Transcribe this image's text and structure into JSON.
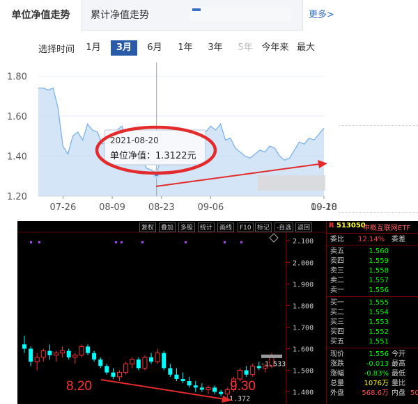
{
  "top_panel": {
    "tabs": [
      {
        "label": "单位净值走势",
        "active": true
      },
      {
        "label": "累计净值走势",
        "active": false
      }
    ],
    "more_label": "更多>",
    "range_label": "选择时间",
    "ranges": [
      {
        "label": "1月",
        "state": "normal"
      },
      {
        "label": "3月",
        "state": "active"
      },
      {
        "label": "6月",
        "state": "normal"
      },
      {
        "label": "1年",
        "state": "normal"
      },
      {
        "label": "3年",
        "state": "normal"
      },
      {
        "label": "5年",
        "state": "disabled"
      },
      {
        "label": "今年来",
        "state": "normal"
      },
      {
        "label": "最大",
        "state": "normal"
      }
    ],
    "tooltip": {
      "date": "2021-08-20",
      "value_label": "单位净值：1.3122元"
    },
    "colors": {
      "area_fill": "#c5dcf5",
      "line": "#7ab3ea",
      "annotation": "#e32b2b",
      "accent": "#2a5ba8"
    }
  },
  "chart_data": [
    {
      "type": "area",
      "title": "单位净值走势",
      "xlabel": "",
      "ylabel": "",
      "y_ticks": [
        "1.20",
        "1.40",
        "1.60",
        "1.80"
      ],
      "ylim": [
        1.2,
        1.85
      ],
      "x_ticks": [
        "07-26",
        "08-09",
        "08-23",
        "09-06",
        "09-20",
        "10-18"
      ],
      "series": [
        {
          "x": [
            "07-19",
            "07-20",
            "07-21",
            "07-22",
            "07-23",
            "07-26",
            "07-27",
            "07-28",
            "07-29",
            "07-30",
            "08-02",
            "08-03",
            "08-04",
            "08-05",
            "08-06",
            "08-09",
            "08-10",
            "08-11",
            "08-12",
            "08-13",
            "08-16",
            "08-17",
            "08-18",
            "08-19",
            "08-20",
            "08-23",
            "08-24",
            "08-25",
            "08-26",
            "08-27",
            "08-30",
            "08-31",
            "09-01",
            "09-02",
            "09-03",
            "09-06",
            "09-07",
            "09-08",
            "09-09",
            "09-10",
            "09-13",
            "09-14",
            "09-15",
            "09-16",
            "09-17",
            "09-22",
            "09-23",
            "09-24",
            "09-27",
            "09-28",
            "09-29",
            "09-30",
            "10-08",
            "10-11",
            "10-12",
            "10-13",
            "10-14",
            "10-15",
            "10-18"
          ],
          "y": [
            1.74,
            1.74,
            1.73,
            1.74,
            1.64,
            1.45,
            1.41,
            1.5,
            1.52,
            1.48,
            1.56,
            1.53,
            1.52,
            1.46,
            1.48,
            1.47,
            1.53,
            1.55,
            1.45,
            1.41,
            1.42,
            1.38,
            1.34,
            1.33,
            1.31,
            1.4,
            1.46,
            1.45,
            1.44,
            1.42,
            1.44,
            1.49,
            1.47,
            1.46,
            1.52,
            1.55,
            1.53,
            1.56,
            1.48,
            1.49,
            1.44,
            1.42,
            1.4,
            1.39,
            1.41,
            1.43,
            1.42,
            1.45,
            1.44,
            1.4,
            1.38,
            1.39,
            1.43,
            1.47,
            1.46,
            1.49,
            1.48,
            1.51,
            1.54
          ]
        }
      ]
    },
    {
      "type": "candlestick",
      "title": "513050 中概互联网ETF",
      "y_ticks": [
        "1.400",
        "1.500",
        "1.600",
        "1.700",
        "1.800",
        "1.900",
        "2.000",
        "2.100"
      ],
      "ylim": [
        1.36,
        2.12
      ],
      "series": [
        {
          "name": "K线",
          "values": [
            {
              "o": 1.62,
              "h": 1.66,
              "l": 1.58,
              "c": 1.6
            },
            {
              "o": 1.6,
              "h": 1.61,
              "l": 1.52,
              "c": 1.54
            },
            {
              "o": 1.54,
              "h": 1.58,
              "l": 1.5,
              "c": 1.56
            },
            {
              "o": 1.56,
              "h": 1.6,
              "l": 1.54,
              "c": 1.59
            },
            {
              "o": 1.59,
              "h": 1.62,
              "l": 1.55,
              "c": 1.57
            },
            {
              "o": 1.57,
              "h": 1.59,
              "l": 1.54,
              "c": 1.58
            },
            {
              "o": 1.58,
              "h": 1.61,
              "l": 1.56,
              "c": 1.59
            },
            {
              "o": 1.59,
              "h": 1.6,
              "l": 1.55,
              "c": 1.56
            },
            {
              "o": 1.56,
              "h": 1.58,
              "l": 1.53,
              "c": 1.57
            },
            {
              "o": 1.57,
              "h": 1.62,
              "l": 1.56,
              "c": 1.61
            },
            {
              "o": 1.61,
              "h": 1.62,
              "l": 1.57,
              "c": 1.58
            },
            {
              "o": 1.58,
              "h": 1.59,
              "l": 1.54,
              "c": 1.55
            },
            {
              "o": 1.55,
              "h": 1.56,
              "l": 1.51,
              "c": 1.52
            },
            {
              "o": 1.52,
              "h": 1.53,
              "l": 1.48,
              "c": 1.49
            },
            {
              "o": 1.49,
              "h": 1.51,
              "l": 1.46,
              "c": 1.47
            },
            {
              "o": 1.47,
              "h": 1.5,
              "l": 1.45,
              "c": 1.49
            },
            {
              "o": 1.49,
              "h": 1.54,
              "l": 1.48,
              "c": 1.53
            },
            {
              "o": 1.53,
              "h": 1.56,
              "l": 1.51,
              "c": 1.55
            },
            {
              "o": 1.55,
              "h": 1.56,
              "l": 1.5,
              "c": 1.51
            },
            {
              "o": 1.51,
              "h": 1.57,
              "l": 1.5,
              "c": 1.56
            },
            {
              "o": 1.56,
              "h": 1.58,
              "l": 1.53,
              "c": 1.54
            },
            {
              "o": 1.54,
              "h": 1.6,
              "l": 1.53,
              "c": 1.58
            },
            {
              "o": 1.58,
              "h": 1.59,
              "l": 1.5,
              "c": 1.51
            },
            {
              "o": 1.51,
              "h": 1.53,
              "l": 1.47,
              "c": 1.48
            },
            {
              "o": 1.48,
              "h": 1.51,
              "l": 1.45,
              "c": 1.46
            },
            {
              "o": 1.46,
              "h": 1.49,
              "l": 1.44,
              "c": 1.45
            },
            {
              "o": 1.45,
              "h": 1.47,
              "l": 1.42,
              "c": 1.43
            },
            {
              "o": 1.43,
              "h": 1.45,
              "l": 1.4,
              "c": 1.42
            },
            {
              "o": 1.42,
              "h": 1.44,
              "l": 1.4,
              "c": 1.41
            },
            {
              "o": 1.41,
              "h": 1.43,
              "l": 1.39,
              "c": 1.42
            },
            {
              "o": 1.42,
              "h": 1.43,
              "l": 1.39,
              "c": 1.4
            },
            {
              "o": 1.4,
              "h": 1.41,
              "l": 1.38,
              "c": 1.39
            },
            {
              "o": 1.39,
              "h": 1.42,
              "l": 1.37,
              "c": 1.41
            },
            {
              "o": 1.41,
              "h": 1.47,
              "l": 1.4,
              "c": 1.46
            },
            {
              "o": 1.46,
              "h": 1.51,
              "l": 1.45,
              "c": 1.5
            },
            {
              "o": 1.5,
              "h": 1.52,
              "l": 1.47,
              "c": 1.48
            },
            {
              "o": 1.48,
              "h": 1.53,
              "l": 1.47,
              "c": 1.52
            },
            {
              "o": 1.52,
              "h": 1.54,
              "l": 1.5,
              "c": 1.51
            },
            {
              "o": 1.51,
              "h": 1.53,
              "l": 1.49,
              "c": 1.52
            },
            {
              "o": 1.52,
              "h": 1.58,
              "l": 1.51,
              "c": 1.56
            }
          ]
        }
      ],
      "annotations": [
        "1.533",
        "1.372"
      ]
    }
  ],
  "overlay": {
    "left_label": "8.20",
    "right_label": "9.30"
  },
  "kline": {
    "toolbar": [
      "复权",
      "叠加",
      "多股",
      "统计",
      "画线",
      "F10",
      "标记",
      "-自选",
      "返回"
    ],
    "axis_labels": [
      "2.100",
      "2.000",
      "1.900",
      "1.800",
      "1.700",
      "1.600",
      "1.500",
      "1.400"
    ]
  },
  "quote": {
    "code": "513050",
    "name": "中概互联网ETF",
    "webi_label": "委比",
    "webi_value": "12.14%",
    "weicha_label": "委差",
    "asks": [
      {
        "label": "卖五",
        "price": "1.560"
      },
      {
        "label": "卖四",
        "price": "1.559"
      },
      {
        "label": "卖三",
        "price": "1.558"
      },
      {
        "label": "卖二",
        "price": "1.557"
      },
      {
        "label": "卖一",
        "price": "1.556"
      }
    ],
    "bids": [
      {
        "label": "买一",
        "price": "1.555"
      },
      {
        "label": "买二",
        "price": "1.554"
      },
      {
        "label": "买三",
        "price": "1.553"
      },
      {
        "label": "买四",
        "price": "1.552"
      },
      {
        "label": "买五",
        "price": "1.551"
      }
    ],
    "stats": [
      {
        "l1": "现价",
        "v1": "1.556",
        "l2": "今开",
        "c1": "#00ff00"
      },
      {
        "l1": "涨跌",
        "v1": "-0.013",
        "l2": "最高",
        "c1": "#00ff00"
      },
      {
        "l1": "涨幅",
        "v1": "-0.83%",
        "l2": "最低",
        "c1": "#00ff00"
      },
      {
        "l1": "总量",
        "v1": "1076万",
        "l2": "量比",
        "c1": "#ffff00"
      },
      {
        "l1": "外盘",
        "v1": "568.6万",
        "l2": "内盘",
        "c1": "#ff5050",
        "v2": "50"
      }
    ]
  }
}
